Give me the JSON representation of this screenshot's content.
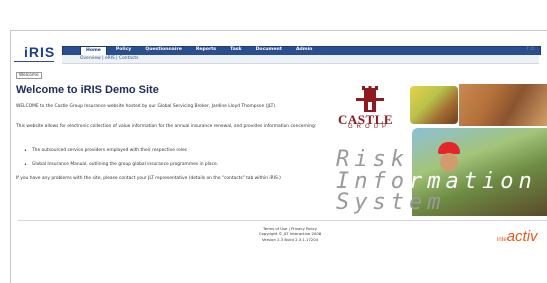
{
  "header": {
    "logo_text": "iRIS",
    "tabs": [
      "Home",
      "Policy",
      "Questionnaire",
      "Reports",
      "Task",
      "Document",
      "Admin"
    ],
    "active_tab": "Home",
    "subnav": "Overview | eRIS | Contacts"
  },
  "breadcrumb": "Welcome",
  "main": {
    "title": "Welcome to iRIS Demo Site",
    "para1": "WELCOME to the Castle Group Insurance website hosted by our Global Servicing Broker, Jardine Lloyd Thompson (JLT).",
    "para2": "This website allows for electronic collection of value information for the annual insurance renewal, and provides information concerning:",
    "bullets": [
      "The outsourced service providers employed with their respective roles",
      "Global Insurance Manual, outlining the group global insurance programmes in place."
    ],
    "para3": "If you have any problems with the site, please contact your JLT representative (details on the \"contacts\" tab within iRIS.)"
  },
  "brand": {
    "castle_name": "CASTLE",
    "castle_group": "GROUP",
    "tagline": [
      "Risk",
      "Information",
      "System"
    ]
  },
  "footer": {
    "links": "Terms of Use | Privacy Policy",
    "copyright": "Copyright © JLT Interactive 2008",
    "version": "Version 2.3 Build 2.3.1.17204",
    "vendor_small": "inte",
    "vendor_big": "activ"
  },
  "colors": {
    "nav_blue": "#2a4f8f",
    "title_navy": "#1d2c5e",
    "castle_red": "#8c1a20",
    "vendor_orange": "#e85a1a"
  }
}
